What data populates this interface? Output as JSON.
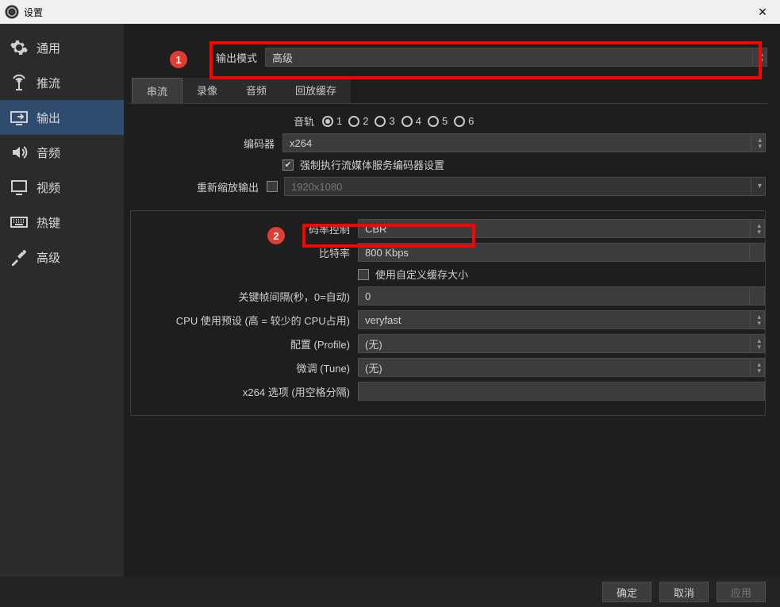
{
  "window": {
    "title": "设置"
  },
  "sidebar": {
    "items": [
      {
        "label": "通用"
      },
      {
        "label": "推流"
      },
      {
        "label": "输出"
      },
      {
        "label": "音频"
      },
      {
        "label": "视频"
      },
      {
        "label": "热键"
      },
      {
        "label": "高级"
      }
    ]
  },
  "output_mode": {
    "label": "输出模式",
    "value": "高级"
  },
  "tabs": {
    "stream": "串流",
    "record": "录像",
    "audio": "音频",
    "replay": "回放缓存"
  },
  "form": {
    "audio_track": {
      "label": "音轨",
      "options": [
        "1",
        "2",
        "3",
        "4",
        "5",
        "6"
      ],
      "selected": "1"
    },
    "encoder": {
      "label": "编码器",
      "value": "x264"
    },
    "enforce_settings": {
      "label": "强制执行流媒体服务编码器设置",
      "checked": true
    },
    "rescale": {
      "label": "重新缩放输出",
      "checked": false,
      "value": "1920x1080"
    },
    "rate_control": {
      "label": "码率控制",
      "value": "CBR"
    },
    "bitrate": {
      "label": "比特率",
      "value": "800 Kbps"
    },
    "custom_buffer": {
      "label": "使用自定义缓存大小",
      "checked": false
    },
    "keyint": {
      "label": "关键帧间隔(秒，0=自动)",
      "value": "0"
    },
    "cpu_preset": {
      "label": "CPU 使用预设 (高 = 较少的 CPU占用)",
      "value": "veryfast"
    },
    "profile": {
      "label": "配置 (Profile)",
      "value": "(无)"
    },
    "tune": {
      "label": "微调 (Tune)",
      "value": "(无)"
    },
    "x264opts": {
      "label": "x264 选项 (用空格分隔)",
      "value": ""
    }
  },
  "annotations": {
    "badge1": "1",
    "badge2": "2"
  },
  "footer": {
    "ok": "确定",
    "cancel": "取消",
    "apply": "应用"
  }
}
